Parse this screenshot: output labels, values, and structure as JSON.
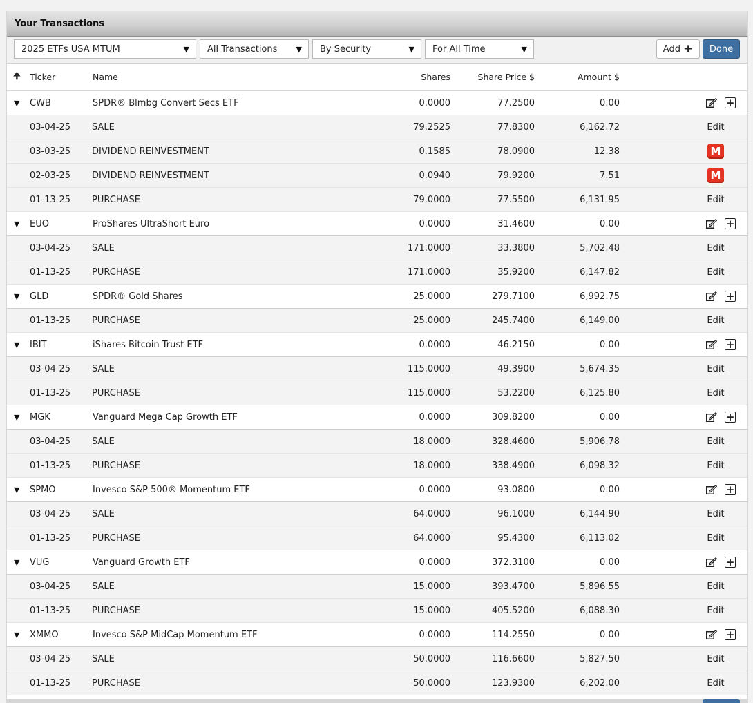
{
  "title": "Your Transactions",
  "toolbar": {
    "portfolio": "2025 ETFs USA MTUM",
    "transaction_filter": "All Transactions",
    "group_by": "By Security",
    "period": "For All Time",
    "add_label": "Add",
    "done_label": "Done"
  },
  "columns": {
    "ticker": "Ticker",
    "name": "Name",
    "shares": "Shares",
    "share_price": "Share Price $",
    "amount": "Amount $"
  },
  "groups": [
    {
      "ticker": "CWB",
      "name": "SPDR® Blmbg Convert Secs ETF",
      "shares": "0.0000",
      "price": "77.2500",
      "amount": "0.00",
      "rows": [
        {
          "date": "03-04-25",
          "type": "SALE",
          "shares": "79.2525",
          "price": "77.8300",
          "amount": "6,162.72",
          "action": "Edit"
        },
        {
          "date": "03-03-25",
          "type": "DIVIDEND REINVESTMENT",
          "shares": "0.1585",
          "price": "78.0900",
          "amount": "12.38",
          "action": "M"
        },
        {
          "date": "02-03-25",
          "type": "DIVIDEND REINVESTMENT",
          "shares": "0.0940",
          "price": "79.9200",
          "amount": "7.51",
          "action": "M"
        },
        {
          "date": "01-13-25",
          "type": "PURCHASE",
          "shares": "79.0000",
          "price": "77.5500",
          "amount": "6,131.95",
          "action": "Edit"
        }
      ]
    },
    {
      "ticker": "EUO",
      "name": "ProShares UltraShort Euro",
      "shares": "0.0000",
      "price": "31.4600",
      "amount": "0.00",
      "rows": [
        {
          "date": "03-04-25",
          "type": "SALE",
          "shares": "171.0000",
          "price": "33.3800",
          "amount": "5,702.48",
          "action": "Edit"
        },
        {
          "date": "01-13-25",
          "type": "PURCHASE",
          "shares": "171.0000",
          "price": "35.9200",
          "amount": "6,147.82",
          "action": "Edit"
        }
      ]
    },
    {
      "ticker": "GLD",
      "name": "SPDR® Gold Shares",
      "shares": "25.0000",
      "price": "279.7100",
      "amount": "6,992.75",
      "rows": [
        {
          "date": "01-13-25",
          "type": "PURCHASE",
          "shares": "25.0000",
          "price": "245.7400",
          "amount": "6,149.00",
          "action": "Edit"
        }
      ]
    },
    {
      "ticker": "IBIT",
      "name": "iShares Bitcoin Trust ETF",
      "shares": "0.0000",
      "price": "46.2150",
      "amount": "0.00",
      "rows": [
        {
          "date": "03-04-25",
          "type": "SALE",
          "shares": "115.0000",
          "price": "49.3900",
          "amount": "5,674.35",
          "action": "Edit"
        },
        {
          "date": "01-13-25",
          "type": "PURCHASE",
          "shares": "115.0000",
          "price": "53.2200",
          "amount": "6,125.80",
          "action": "Edit"
        }
      ]
    },
    {
      "ticker": "MGK",
      "name": "Vanguard Mega Cap Growth ETF",
      "shares": "0.0000",
      "price": "309.8200",
      "amount": "0.00",
      "rows": [
        {
          "date": "03-04-25",
          "type": "SALE",
          "shares": "18.0000",
          "price": "328.4600",
          "amount": "5,906.78",
          "action": "Edit"
        },
        {
          "date": "01-13-25",
          "type": "PURCHASE",
          "shares": "18.0000",
          "price": "338.4900",
          "amount": "6,098.32",
          "action": "Edit"
        }
      ]
    },
    {
      "ticker": "SPMO",
      "name": "Invesco S&P 500® Momentum ETF",
      "shares": "0.0000",
      "price": "93.0800",
      "amount": "0.00",
      "rows": [
        {
          "date": "03-04-25",
          "type": "SALE",
          "shares": "64.0000",
          "price": "96.1000",
          "amount": "6,144.90",
          "action": "Edit"
        },
        {
          "date": "01-13-25",
          "type": "PURCHASE",
          "shares": "64.0000",
          "price": "95.4300",
          "amount": "6,113.02",
          "action": "Edit"
        }
      ]
    },
    {
      "ticker": "VUG",
      "name": "Vanguard Growth ETF",
      "shares": "0.0000",
      "price": "372.3100",
      "amount": "0.00",
      "rows": [
        {
          "date": "03-04-25",
          "type": "SALE",
          "shares": "15.0000",
          "price": "393.4700",
          "amount": "5,896.55",
          "action": "Edit"
        },
        {
          "date": "01-13-25",
          "type": "PURCHASE",
          "shares": "15.0000",
          "price": "405.5200",
          "amount": "6,088.30",
          "action": "Edit"
        }
      ]
    },
    {
      "ticker": "XMMO",
      "name": "Invesco S&P MidCap Momentum ETF",
      "shares": "0.0000",
      "price": "114.2550",
      "amount": "0.00",
      "rows": [
        {
          "date": "03-04-25",
          "type": "SALE",
          "shares": "50.0000",
          "price": "116.6600",
          "amount": "5,827.50",
          "action": "Edit"
        },
        {
          "date": "01-13-25",
          "type": "PURCHASE",
          "shares": "50.0000",
          "price": "123.9300",
          "amount": "6,202.00",
          "action": "Edit"
        }
      ]
    }
  ]
}
